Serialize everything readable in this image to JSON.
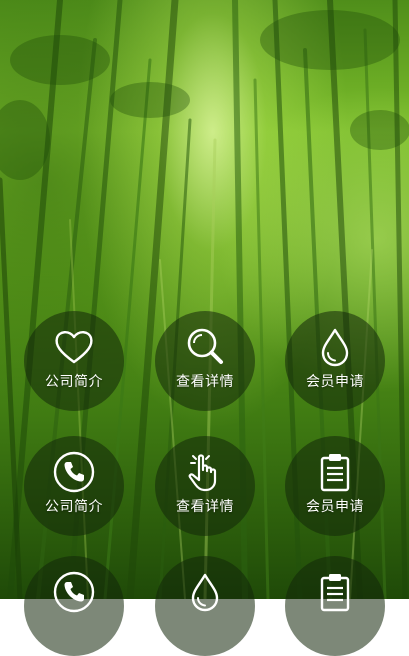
{
  "background": {
    "icon": "bamboo-forest-background"
  },
  "menu": {
    "items": [
      {
        "label": "公司简介",
        "icon": "heart-icon"
      },
      {
        "label": "查看详情",
        "icon": "search-icon"
      },
      {
        "label": "会员申请",
        "icon": "water-drop-icon"
      },
      {
        "label": "公司简介",
        "icon": "phone-icon"
      },
      {
        "label": "查看详情",
        "icon": "hand-pointer-icon"
      },
      {
        "label": "会员申请",
        "icon": "clipboard-icon"
      },
      {
        "label": "",
        "icon": "phone-icon"
      },
      {
        "label": "",
        "icon": "water-drop-icon"
      },
      {
        "label": "",
        "icon": "clipboard-icon"
      }
    ]
  }
}
